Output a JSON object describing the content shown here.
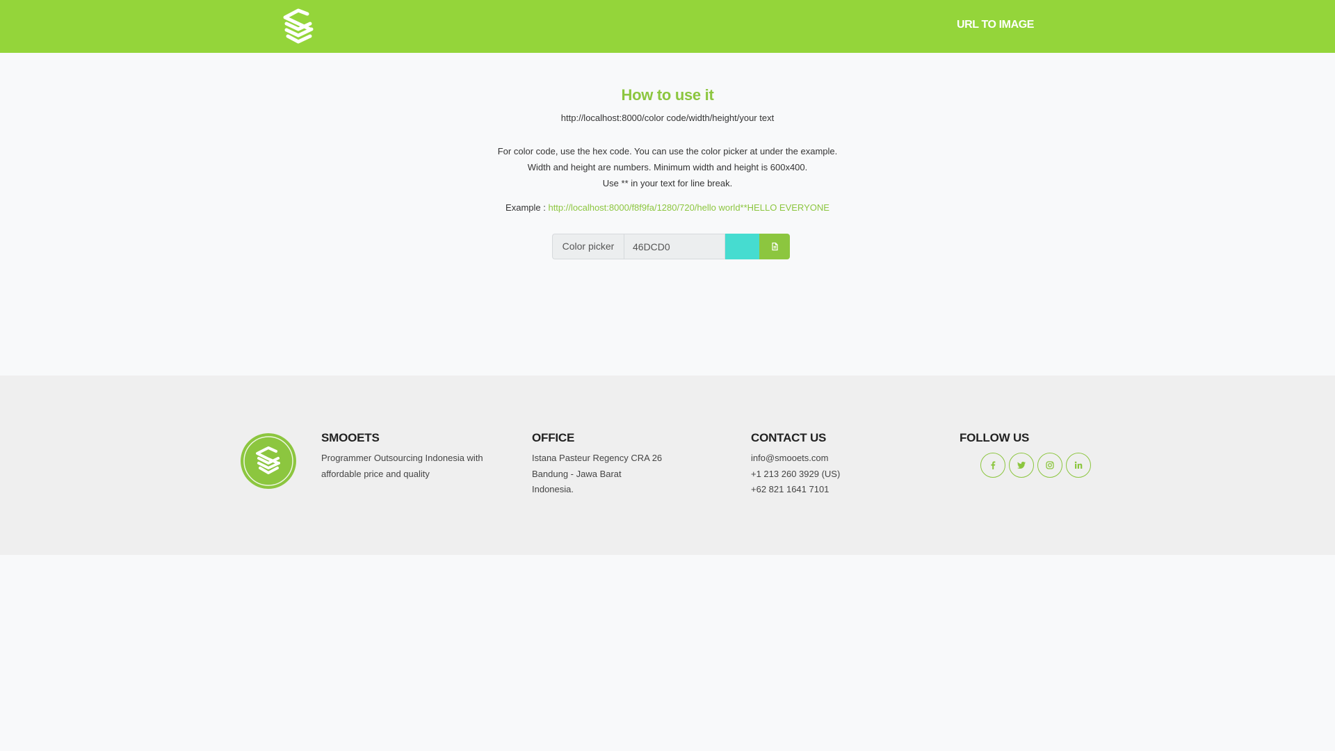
{
  "nav": {
    "logo_icon": "smooets-logo-icon",
    "link_label": "URL TO IMAGE"
  },
  "main": {
    "title": "How to use it",
    "url_pattern": "http://localhost:8000/color code/width/height/your text",
    "instructions": [
      "For color code, use the hex code. You can use the color picker at under the example.",
      "Width and height are numbers. Minimum width and height is 600x400.",
      "Use ** in your text for line break."
    ],
    "example_label": "Example : ",
    "example_link": "http://localhost:8000/f8f9fa/1280/720/hello world**HELLO EVERYONE"
  },
  "picker": {
    "label": "Color picker",
    "value": "46DCD0",
    "swatch_color": "#46dcd0",
    "copy_icon": "copy-icon"
  },
  "footer": {
    "smooets": {
      "title": "SMOOETS",
      "lines": [
        "Programmer Outsourcing Indonesia with",
        "affordable price and quality"
      ]
    },
    "office": {
      "title": "OFFICE",
      "lines": [
        "Istana Pasteur Regency CRA 26",
        "Bandung - Jawa Barat",
        "Indonesia."
      ]
    },
    "contact": {
      "title": "CONTACT US",
      "lines": [
        "info@smooets.com",
        "+1 213 260 3929 (US)",
        "+62 821 1641 7101"
      ]
    },
    "follow": {
      "title": "FOLLOW US",
      "icons": [
        "facebook-icon",
        "twitter-icon",
        "instagram-icon",
        "linkedin-icon"
      ]
    }
  },
  "colors": {
    "brand_green": "#94d53a",
    "accent_green": "#8cc63f",
    "footer_bg": "#efefef",
    "page_bg": "#f8f9fa"
  }
}
